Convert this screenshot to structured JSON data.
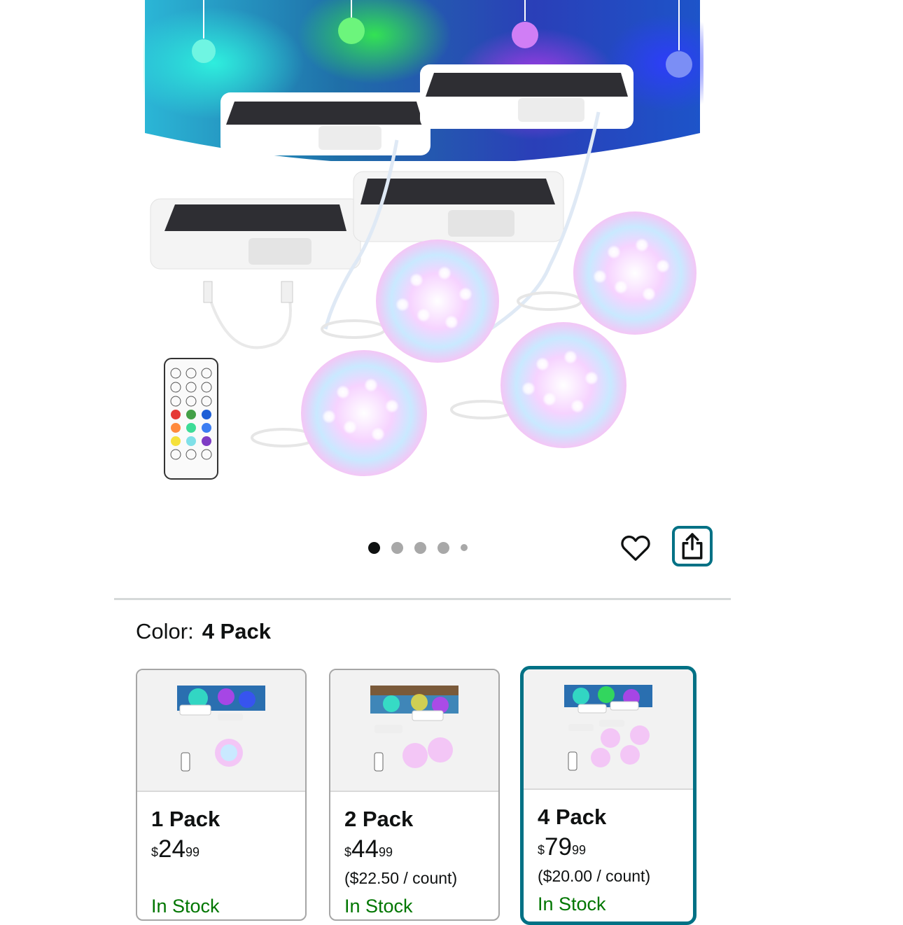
{
  "gallery": {
    "image_alt": "Solar pool lights 4 pack with remote control",
    "dot_count": 5,
    "active_index": 0
  },
  "actions": {
    "wishlist_icon": "heart-outline-icon",
    "share_icon": "share-icon"
  },
  "variant": {
    "label": "Color:",
    "selected_value": "4 Pack"
  },
  "options": [
    {
      "title": "1 Pack",
      "currency": "$",
      "whole": "24",
      "fraction": "99",
      "unit_price": "",
      "stock": "In Stock"
    },
    {
      "title": "2 Pack",
      "currency": "$",
      "whole": "44",
      "fraction": "99",
      "unit_price": "($22.50 / count)",
      "stock": "In Stock"
    },
    {
      "title": "4 Pack",
      "currency": "$",
      "whole": "79",
      "fraction": "99",
      "unit_price": "($20.00 / count)",
      "stock": "In Stock"
    }
  ],
  "colors": {
    "accent": "#007185",
    "stock": "#007600",
    "divider": "#d5d9d9"
  }
}
